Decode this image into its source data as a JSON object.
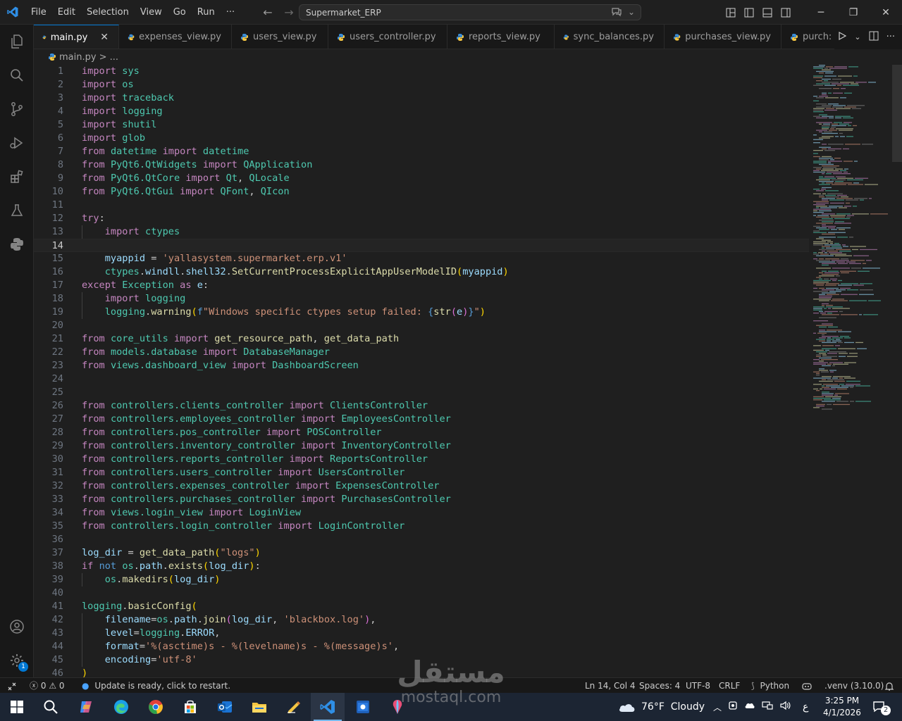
{
  "titlebar": {
    "menu": [
      "File",
      "Edit",
      "Selection",
      "View",
      "Go",
      "Run",
      "···"
    ],
    "search_text": "Supermarket_ERP"
  },
  "tabs": [
    {
      "label": "main.py",
      "active": true
    },
    {
      "label": "expenses_view.py"
    },
    {
      "label": "users_view.py"
    },
    {
      "label": "users_controller.py"
    },
    {
      "label": "reports_view.py"
    },
    {
      "label": "sync_balances.py"
    },
    {
      "label": "purchases_view.py"
    },
    {
      "label": "purch:"
    }
  ],
  "breadcrumb": {
    "file": "main.py",
    "rest": "> ..."
  },
  "editor": {
    "current_line": 14,
    "lines": [
      {
        "n": "1",
        "html": "<span class='kw'>import</span> <span class='cls'>sys</span>"
      },
      {
        "n": "2",
        "html": "<span class='kw'>import</span> <span class='cls'>os</span>"
      },
      {
        "n": "3",
        "html": "<span class='kw'>import</span> <span class='cls'>traceback</span>"
      },
      {
        "n": "4",
        "html": "<span class='kw'>import</span> <span class='cls'>logging</span>"
      },
      {
        "n": "5",
        "html": "<span class='kw'>import</span> <span class='cls'>shutil</span>"
      },
      {
        "n": "6",
        "html": "<span class='kw'>import</span> <span class='cls'>glob</span>"
      },
      {
        "n": "7",
        "html": "<span class='kw'>from</span> <span class='cls'>datetime</span> <span class='kw'>import</span> <span class='cls'>datetime</span>"
      },
      {
        "n": "8",
        "html": "<span class='kw'>from</span> <span class='cls'>PyQt6.QtWidgets</span> <span class='kw'>import</span> <span class='cls'>QApplication</span>"
      },
      {
        "n": "9",
        "html": "<span class='kw'>from</span> <span class='cls'>PyQt6.QtCore</span> <span class='kw'>import</span> <span class='cls'>Qt</span>, <span class='cls'>QLocale</span>"
      },
      {
        "n": "10",
        "html": "<span class='kw'>from</span> <span class='cls'>PyQt6.QtGui</span> <span class='kw'>import</span> <span class='cls'>QFont</span>, <span class='cls'>QIcon</span>"
      },
      {
        "n": "11",
        "html": ""
      },
      {
        "n": "12",
        "html": "<span class='kw'>try</span>:"
      },
      {
        "n": "13",
        "html": "    <span class='kw'>import</span> <span class='cls'>ctypes</span>"
      },
      {
        "n": "14",
        "html": ""
      },
      {
        "n": "15",
        "html": "    <span class='var'>myappid</span> = <span class='str'>'yallasystem.supermarket.erp.v1'</span>"
      },
      {
        "n": "16",
        "html": "    <span class='cls'>ctypes</span>.<span class='var'>windll</span>.<span class='var'>shell32</span>.<span class='fn'>SetCurrentProcessExplicitAppUserModelID</span><span class='pn'>(</span><span class='var'>myappid</span><span class='pn'>)</span>"
      },
      {
        "n": "17",
        "html": "<span class='kw'>except</span> <span class='cls'>Exception</span> <span class='kw'>as</span> <span class='var'>e</span>:"
      },
      {
        "n": "18",
        "html": "    <span class='kw'>import</span> <span class='cls'>logging</span>"
      },
      {
        "n": "19",
        "html": "    <span class='cls'>logging</span>.<span class='fn'>warning</span><span class='pn'>(</span><span class='kb'>f</span><span class='str'>\"Windows specific ctypes setup failed: </span><span class='kb'>{</span><span class='fn'>str</span><span class='pn2'>(</span><span class='var'>e</span><span class='pn2'>)</span><span class='kb'>}</span><span class='str'>\"</span><span class='pn'>)</span>"
      },
      {
        "n": "20",
        "html": ""
      },
      {
        "n": "21",
        "html": "<span class='kw'>from</span> <span class='cls'>core_utils</span> <span class='kw'>import</span> <span class='fn'>get_resource_path</span>, <span class='fn'>get_data_path</span>"
      },
      {
        "n": "22",
        "html": "<span class='kw'>from</span> <span class='cls'>models.database</span> <span class='kw'>import</span> <span class='cls'>DatabaseManager</span>"
      },
      {
        "n": "23",
        "html": "<span class='kw'>from</span> <span class='cls'>views.dashboard_view</span> <span class='kw'>import</span> <span class='cls'>DashboardScreen</span>"
      },
      {
        "n": "24",
        "html": ""
      },
      {
        "n": "25",
        "html": ""
      },
      {
        "n": "26",
        "html": "<span class='kw'>from</span> <span class='cls'>controllers.clients_controller</span> <span class='kw'>import</span> <span class='cls'>ClientsController</span>"
      },
      {
        "n": "27",
        "html": "<span class='kw'>from</span> <span class='cls'>controllers.employees_controller</span> <span class='kw'>import</span> <span class='cls'>EmployeesController</span>"
      },
      {
        "n": "28",
        "html": "<span class='kw'>from</span> <span class='cls'>controllers.pos_controller</span> <span class='kw'>import</span> <span class='cls'>POSController</span>"
      },
      {
        "n": "29",
        "html": "<span class='kw'>from</span> <span class='cls'>controllers.inventory_controller</span> <span class='kw'>import</span> <span class='cls'>InventoryController</span>"
      },
      {
        "n": "30",
        "html": "<span class='kw'>from</span> <span class='cls'>controllers.reports_controller</span> <span class='kw'>import</span> <span class='cls'>ReportsController</span>"
      },
      {
        "n": "31",
        "html": "<span class='kw'>from</span> <span class='cls'>controllers.users_controller</span> <span class='kw'>import</span> <span class='cls'>UsersController</span>"
      },
      {
        "n": "32",
        "html": "<span class='kw'>from</span> <span class='cls'>controllers.expenses_controller</span> <span class='kw'>import</span> <span class='cls'>ExpensesController</span>"
      },
      {
        "n": "33",
        "html": "<span class='kw'>from</span> <span class='cls'>controllers.purchases_controller</span> <span class='kw'>import</span> <span class='cls'>PurchasesController</span>"
      },
      {
        "n": "34",
        "html": "<span class='kw'>from</span> <span class='cls'>views.login_view</span> <span class='kw'>import</span> <span class='cls'>LoginView</span>"
      },
      {
        "n": "35",
        "html": "<span class='kw'>from</span> <span class='cls'>controllers.login_controller</span> <span class='kw'>import</span> <span class='cls'>LoginController</span>"
      },
      {
        "n": "36",
        "html": ""
      },
      {
        "n": "37",
        "html": "<span class='var'>log_dir</span> = <span class='fn'>get_data_path</span><span class='pn'>(</span><span class='str'>\"logs\"</span><span class='pn'>)</span>"
      },
      {
        "n": "38",
        "html": "<span class='kw'>if</span> <span class='kb'>not</span> <span class='cls'>os</span>.<span class='var'>path</span>.<span class='fn'>exists</span><span class='pn'>(</span><span class='var'>log_dir</span><span class='pn'>)</span>:"
      },
      {
        "n": "39",
        "html": "    <span class='cls'>os</span>.<span class='fn'>makedirs</span><span class='pn'>(</span><span class='var'>log_dir</span><span class='pn'>)</span>"
      },
      {
        "n": "40",
        "html": ""
      },
      {
        "n": "41",
        "html": "<span class='cls'>logging</span>.<span class='fn'>basicConfig</span><span class='pn'>(</span>"
      },
      {
        "n": "42",
        "html": "    <span class='var'>filename</span>=<span class='cls'>os</span>.<span class='var'>path</span>.<span class='fn'>join</span><span class='pn2'>(</span><span class='var'>log_dir</span>, <span class='str'>'blackbox.log'</span><span class='pn2'>)</span>,"
      },
      {
        "n": "43",
        "html": "    <span class='var'>level</span>=<span class='cls'>logging</span>.<span class='var'>ERROR</span>,"
      },
      {
        "n": "44",
        "html": "    <span class='var'>format</span>=<span class='str'>'%(asctime)s - %(levelname)s - %(message)s'</span>,"
      },
      {
        "n": "45",
        "html": "    <span class='var'>encoding</span>=<span class='str'>'utf-8'</span>"
      },
      {
        "n": "46",
        "html": "<span class='pn'>)</span>"
      }
    ]
  },
  "statusbar": {
    "errors": "0",
    "warnings": "0",
    "update_msg": "Update is ready, click to restart.",
    "position": "Ln 14, Col 4",
    "spaces": "Spaces: 4",
    "encoding": "UTF-8",
    "eol": "CRLF",
    "language": "Python",
    "venv": ".venv (3.10.0)"
  },
  "taskbar": {
    "weather": "76°F  Cloudy",
    "lang": "ع",
    "time": "3:25 PM",
    "date": "4/1/2026",
    "notif_count": "2"
  },
  "activity_badge": "1",
  "watermark": {
    "arabic": "مستقل",
    "latin": "mostaql.com"
  },
  "colors": {
    "accent": "#0078d4",
    "bg": "#1f1f1f",
    "keyword": "#c586c0",
    "class": "#4ec9b0",
    "string": "#ce9178",
    "function": "#dcdcaa"
  }
}
